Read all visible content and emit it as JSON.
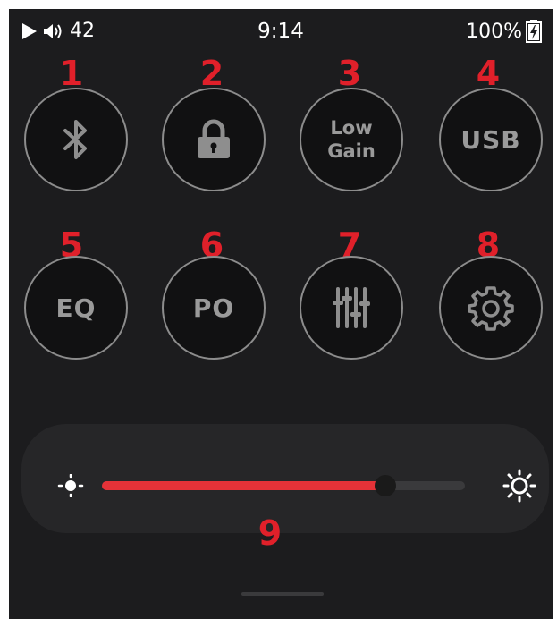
{
  "status_bar": {
    "volume": "42",
    "time": "9:14",
    "battery": "100%"
  },
  "quick_settings": [
    {
      "number": "1",
      "icon": "bluetooth-icon"
    },
    {
      "number": "2",
      "icon": "lock-icon"
    },
    {
      "number": "3",
      "label_line1": "Low",
      "label_line2": "Gain"
    },
    {
      "number": "4",
      "label": "USB"
    },
    {
      "number": "5",
      "label": "EQ"
    },
    {
      "number": "6",
      "label": "PO"
    },
    {
      "number": "7",
      "icon": "sliders-icon"
    },
    {
      "number": "8",
      "icon": "gear-icon"
    }
  ],
  "brightness": {
    "number": "9",
    "level": 0.78,
    "fill_color": "#e53238"
  },
  "annotation_color": "#e0202a"
}
